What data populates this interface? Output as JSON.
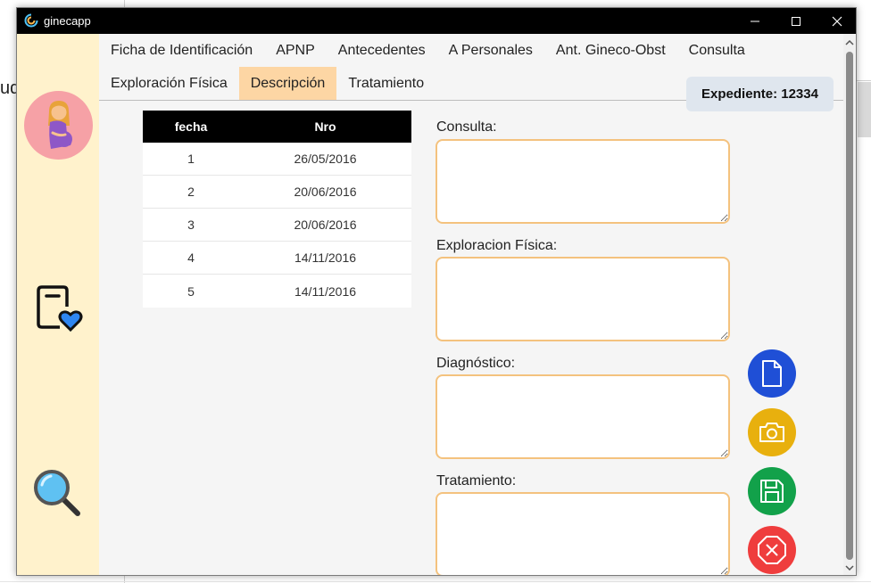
{
  "background": {
    "fragment_text": "ud"
  },
  "window": {
    "title": "ginecapp",
    "controls": [
      "minimize",
      "maximize",
      "close"
    ]
  },
  "sidebar": {
    "items": [
      {
        "icon": "pregnant-woman-icon"
      },
      {
        "icon": "document-heart-icon"
      },
      {
        "icon": "search-icon"
      }
    ]
  },
  "tabs": {
    "row1": [
      {
        "label": "Ficha de Identificación"
      },
      {
        "label": "APNP"
      },
      {
        "label": "Antecedentes"
      },
      {
        "label": "A Personales"
      },
      {
        "label": "Ant. Gineco-Obst"
      },
      {
        "label": "Consulta"
      }
    ],
    "row2": [
      {
        "label": "Exploración Física"
      },
      {
        "label": "Descripción",
        "active": true
      },
      {
        "label": "Tratamiento"
      }
    ]
  },
  "expediente": {
    "label": "Expediente: 12334"
  },
  "table": {
    "headers": [
      "fecha",
      "Nro"
    ],
    "rows": [
      [
        "1",
        "26/05/2016"
      ],
      [
        "2",
        "20/06/2016"
      ],
      [
        "3",
        "20/06/2016"
      ],
      [
        "4",
        "14/11/2016"
      ],
      [
        "5",
        "14/11/2016"
      ]
    ]
  },
  "form": {
    "consulta_label": "Consulta:",
    "consulta_value": "",
    "exploracion_label": "Exploracion Física:",
    "exploracion_value": "",
    "diagnostico_label": "Diagnóstico:",
    "diagnostico_value": "",
    "tratamiento_label": "Tratamiento:",
    "tratamiento_value": ""
  },
  "actions": [
    {
      "icon": "new-document-icon",
      "color": "#1f4fd6"
    },
    {
      "icon": "camera-icon",
      "color": "#e8b00e"
    },
    {
      "icon": "save-icon",
      "color": "#12a14a"
    },
    {
      "icon": "cancel-icon",
      "color": "#ef3d3d"
    }
  ],
  "colors": {
    "sidebar_bg": "#fff2cc",
    "active_tab": "#fdd6a4",
    "field_border": "#f4c27e",
    "titlebar": "#000000"
  }
}
